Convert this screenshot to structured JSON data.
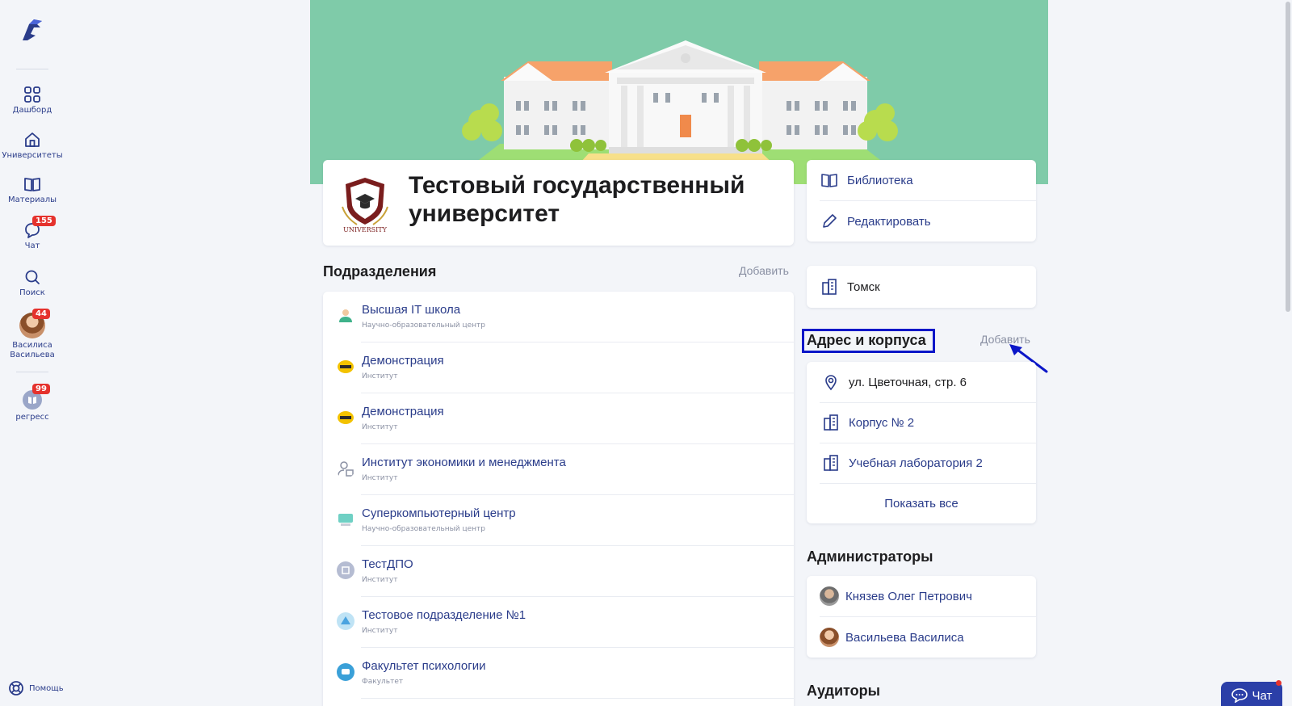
{
  "sidebar": {
    "items": [
      {
        "label": "Дашборд"
      },
      {
        "label": "Университеты"
      },
      {
        "label": "Материалы"
      },
      {
        "label": "Чат",
        "badge": "155"
      },
      {
        "label": "Поиск"
      },
      {
        "label": "Василиса\nВасильева",
        "badge": "44"
      },
      {
        "label": "регресс",
        "badge": "99"
      }
    ],
    "help_label": "Помощь"
  },
  "university": {
    "logo_text": "UNIVERSITY",
    "title": "Тестовый государственный университет"
  },
  "departments": {
    "title": "Подразделения",
    "add_label": "Добавить",
    "items": [
      {
        "name": "Высшая IT школа",
        "type": "Научно-образовательный центр"
      },
      {
        "name": "Демонстрация",
        "type": "Институт"
      },
      {
        "name": "Демонстрация",
        "type": "Институт"
      },
      {
        "name": "Институт экономики и менеджмента",
        "type": "Институт"
      },
      {
        "name": "Суперкомпьютерный центр",
        "type": "Научно-образовательный центр"
      },
      {
        "name": "ТестДПО",
        "type": "Институт"
      },
      {
        "name": "Тестовое подразделение №1",
        "type": "Институт"
      },
      {
        "name": "Факультет психологии",
        "type": "Факультет"
      }
    ]
  },
  "actions": {
    "library": "Библиотека",
    "edit": "Редактировать"
  },
  "city": "Томск",
  "addresses": {
    "title": "Адрес и корпуса",
    "add_label": "Добавить",
    "items": [
      {
        "text": "ул. Цветочная, стр. 6",
        "icon": "location-pin-icon"
      },
      {
        "text": "Корпус № 2",
        "icon": "building-icon"
      },
      {
        "text": "Учебная лаборатория 2",
        "icon": "building-icon"
      }
    ],
    "show_all": "Показать все"
  },
  "admins": {
    "title": "Администраторы",
    "items": [
      "Князев Олег Петрович",
      "Васильева Василиса"
    ]
  },
  "auditoriums": {
    "title": "Аудиторы"
  },
  "chat_button": "Чат",
  "colors": {
    "accent": "#2a3c8a",
    "banner": "#7fcba9",
    "badge": "#e5322d",
    "highlight": "#0b16c8"
  }
}
